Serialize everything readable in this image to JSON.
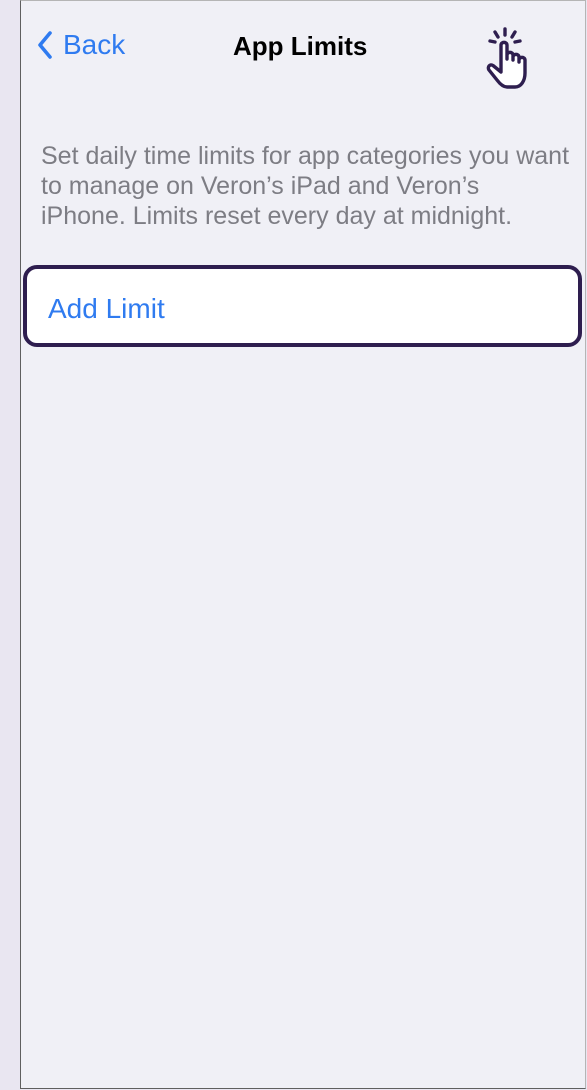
{
  "nav": {
    "back_label": "Back",
    "title": "App Limits"
  },
  "description": "Set daily time limits for app categories you want to manage on Veron’s iPad and Veron’s iPhone. Limits reset every day at midnight.",
  "add_limit": {
    "label": "Add Limit"
  },
  "colors": {
    "accent": "#2f7bf0",
    "highlight_border": "#2e1e4f",
    "background": "#f0f0f6",
    "secondary_text": "#7d7d84"
  },
  "icons": {
    "back": "chevron-left-icon",
    "tap_indicator": "tap-hand-icon"
  }
}
